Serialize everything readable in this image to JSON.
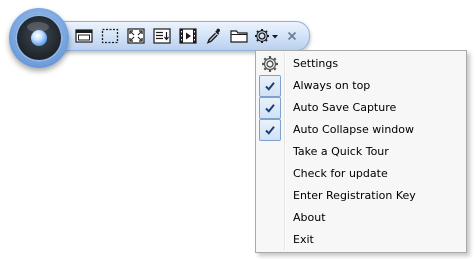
{
  "toolbar": {
    "tools": [
      {
        "icon": "window-capture-icon"
      },
      {
        "icon": "region-capture-icon"
      },
      {
        "icon": "fullscreen-capture-icon"
      },
      {
        "icon": "scrolling-capture-icon"
      },
      {
        "icon": "video-capture-icon"
      },
      {
        "icon": "color-picker-icon"
      },
      {
        "icon": "open-folder-icon"
      },
      {
        "icon": "settings-dropdown-icon"
      },
      {
        "icon": "close-icon"
      }
    ],
    "colors": {
      "bar_top": "#ecf3fd",
      "bar_bottom": "#b9d0f0",
      "icon": "#1b1b1b",
      "close": "#6b7f9c"
    }
  },
  "menu": {
    "items": [
      {
        "label": "Settings",
        "icon": "gear-icon",
        "checked": false
      },
      {
        "label": "Always on top",
        "icon": "",
        "checked": true
      },
      {
        "label": "Auto Save Capture",
        "icon": "",
        "checked": true
      },
      {
        "label": "Auto Collapse window",
        "icon": "",
        "checked": true
      },
      {
        "label": "Take a Quick Tour",
        "icon": "",
        "checked": false
      },
      {
        "label": "Check for update",
        "icon": "",
        "checked": false
      },
      {
        "label": "Enter Registration Key",
        "icon": "",
        "checked": false
      },
      {
        "label": "About",
        "icon": "",
        "checked": false
      },
      {
        "label": "Exit",
        "icon": "",
        "checked": false
      }
    ],
    "colors": {
      "background": "#f7f7f7",
      "check": "#1e3f75",
      "check_box_border": "#7da2ce"
    }
  }
}
